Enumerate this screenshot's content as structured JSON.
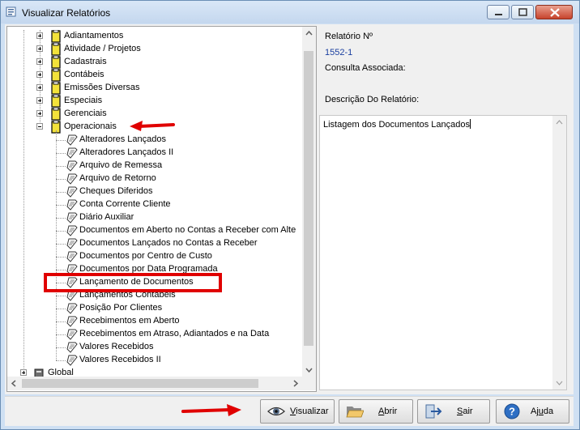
{
  "window": {
    "title": "Visualizar Relatórios"
  },
  "tree": {
    "groups": [
      {
        "label": "Adiantamentos",
        "expanded": false
      },
      {
        "label": "Atividade / Projetos",
        "expanded": false
      },
      {
        "label": "Cadastrais",
        "expanded": false
      },
      {
        "label": "Contábeis",
        "expanded": false
      },
      {
        "label": "Emissões Diversas",
        "expanded": false
      },
      {
        "label": "Especiais",
        "expanded": false
      },
      {
        "label": "Gerenciais",
        "expanded": false
      },
      {
        "label": "Operacionais",
        "expanded": true
      }
    ],
    "operacionais_items": [
      "Alteradores  Lançados",
      "Alteradores  Lançados II",
      "Arquivo de Remessa",
      "Arquivo de Retorno",
      "Cheques Diferidos",
      "Conta Corrente Cliente",
      "Diário  Auxiliar",
      "Documentos em Aberto no Contas a Receber com Alte",
      "Documentos Lançados no Contas a Receber",
      "Documentos por Centro de Custo",
      "Documentos por Data Programada",
      "Lançamento  de Documentos",
      "Lançamentos Contábeis",
      "Posição Por Clientes",
      "Recebimentos em Aberto",
      "Recebimentos em Atraso, Adiantados e na Data",
      "Valores Recebidos",
      "Valores Recebidos II"
    ],
    "highlighted_item": "Lançamento  de Documentos",
    "root_global": "Global"
  },
  "info": {
    "report_number_label": "Relatório Nº",
    "report_number_value": "1552-1",
    "query_label": "Consulta Associada:",
    "description_label": "Descrição Do Relatório:",
    "description_text": "Listagem dos Documentos Lançados"
  },
  "buttons": {
    "visualizar": {
      "mnemonic": "V",
      "rest": "isualizar",
      "icon": "eye-icon"
    },
    "abrir": {
      "mnemonic": "A",
      "rest": "brir",
      "icon": "folder-open-icon"
    },
    "sair": {
      "mnemonic": "S",
      "rest": "air",
      "icon": "exit-icon"
    },
    "ajuda": {
      "pre": "Aj",
      "mnemonic": "u",
      "rest": "da",
      "icon": "help-icon"
    }
  },
  "colors": {
    "annotation_red": "#e00000",
    "link_blue": "#1a3fa0",
    "folder_yellow": "#f3e23a"
  }
}
